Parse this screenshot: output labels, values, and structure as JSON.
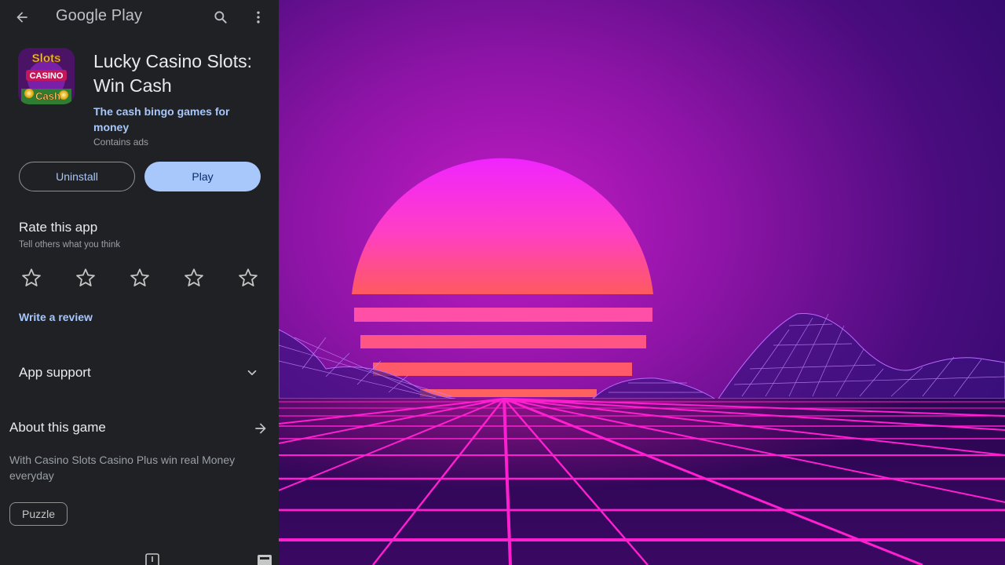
{
  "header": {
    "title": "Google Play",
    "back_icon": "arrow-left-icon",
    "search_icon": "search-icon",
    "more_icon": "more-vert-icon"
  },
  "app": {
    "name": "Lucky Casino Slots: Win Cash",
    "subtitle": "The cash bingo games for money",
    "ads_note": "Contains ads",
    "icon_lettering": [
      "Slots",
      "CASINO",
      "Cash"
    ]
  },
  "actions": {
    "uninstall_label": "Uninstall",
    "play_label": "Play"
  },
  "rating": {
    "title": "Rate this app",
    "subtitle": "Tell others what you think",
    "star_count": 5,
    "selected": 0,
    "write_review_label": "Write a review"
  },
  "support": {
    "title": "App support"
  },
  "about": {
    "title": "About this game",
    "description": "With Casino Slots Casino Plus win real Money everyday",
    "tag": "Puzzle"
  },
  "colors": {
    "panel_bg": "#202124",
    "accent": "#a8c7fa",
    "sun_top": "#f024ff",
    "sun_bottom": "#ff5a5f",
    "grid": "#ff1fd0"
  }
}
